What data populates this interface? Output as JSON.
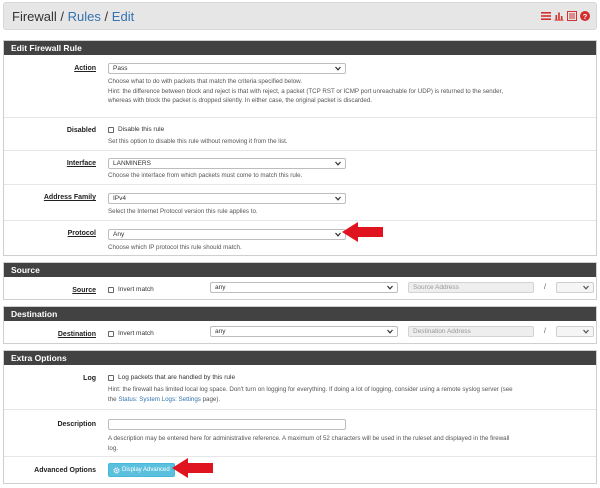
{
  "breadcrumb": {
    "part1": "Firewall",
    "sep1": "/",
    "part2": "Rules",
    "sep2": "/",
    "part3": "Edit"
  },
  "header_icons": [
    "sliders-icon",
    "bar-chart-icon",
    "list-icon",
    "help-icon"
  ],
  "sections": {
    "edit": "Edit Firewall Rule",
    "source": "Source",
    "destination": "Destination",
    "extra": "Extra Options"
  },
  "action": {
    "label": "Action",
    "value": "Pass",
    "help1": "Choose what to do with packets that match the criteria specified below.",
    "help2": "Hint: the difference between block and reject is that with reject, a packet (TCP RST or ICMP port unreachable for UDP) is returned to the sender,",
    "help3": "whereas with block the packet is dropped silently. In either case, the original packet is discarded."
  },
  "disabled": {
    "label": "Disabled",
    "checkbox": "Disable this rule",
    "help": "Set this option to disable this rule without removing it from the list."
  },
  "interface": {
    "label": "Interface",
    "value": "LANMINERS",
    "help": "Choose the interface from which packets must come to match this rule."
  },
  "address_family": {
    "label": "Address Family",
    "value": "IPv4",
    "help": "Select the Internet Protocol version this rule applies to."
  },
  "protocol": {
    "label": "Protocol",
    "value": "Any",
    "help": "Choose which IP protocol this rule should match."
  },
  "source": {
    "label": "Source",
    "invert": "Invert match",
    "type_value": "any",
    "address_placeholder": "Source Address",
    "slash": "/"
  },
  "destination": {
    "label": "Destination",
    "invert": "Invert match",
    "type_value": "any",
    "address_placeholder": "Destination Address",
    "slash": "/"
  },
  "log": {
    "label": "Log",
    "checkbox": "Log packets that are handled by this rule",
    "help1": "Hint: the firewall has limited local log space. Don't turn on logging for everything. If doing a lot of logging, consider using a remote syslog server (see",
    "help2_pre": "the ",
    "help2_link": "Status: System Logs: Settings",
    "help2_post": " page)."
  },
  "description": {
    "label": "Description",
    "value": "",
    "help1": "A description may be entered here for administrative reference. A maximum of 52 characters will be used in the ruleset and displayed in the firewall",
    "help2": "log."
  },
  "advanced": {
    "label": "Advanced Options",
    "button": "Display Advanced"
  },
  "colors": {
    "header": "#424242",
    "link": "#3572b0",
    "button": "#5bc0de",
    "arrow": "#e0141e",
    "topbar": "#e6e6e6"
  }
}
